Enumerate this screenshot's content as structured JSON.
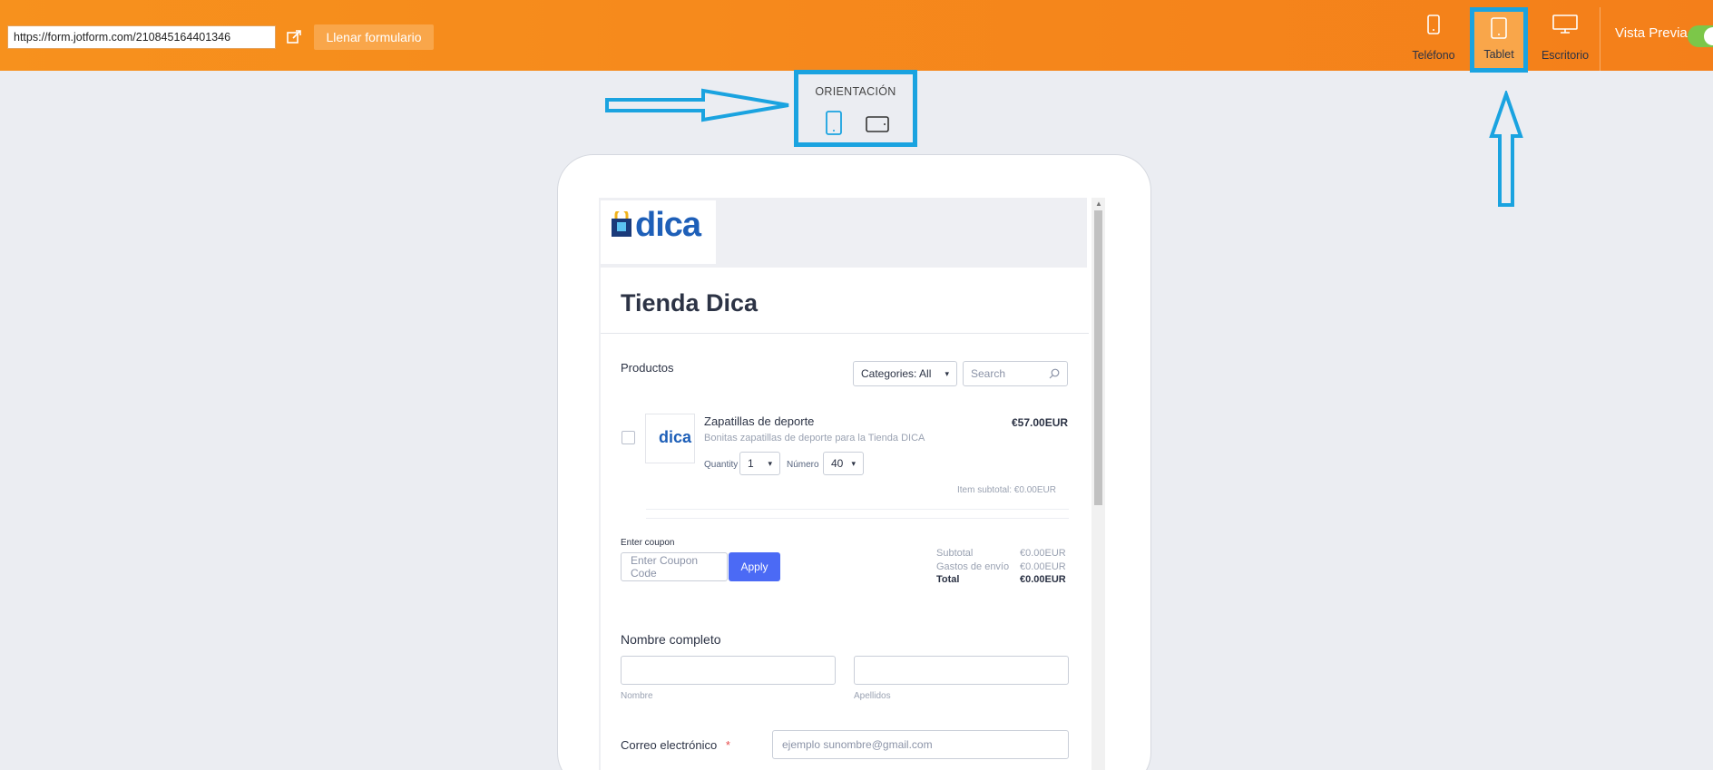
{
  "toolbar": {
    "url": "https://form.jotform.com/210845164401346",
    "fill_button": "Llenar formulario",
    "devices": [
      {
        "label": "Teléfono",
        "icon": "phone-icon"
      },
      {
        "label": "Tablet",
        "icon": "tablet-icon",
        "selected": true
      },
      {
        "label": "Escritorio",
        "icon": "desktop-icon"
      }
    ],
    "preview_label": "Vista Previa",
    "preview_on": true
  },
  "orientation": {
    "label": "ORIENTACIÓN",
    "options": [
      "portrait-icon",
      "landscape-icon"
    ]
  },
  "form": {
    "logo_text": "dica",
    "title": "Tienda Dica",
    "products_label": "Productos",
    "categories_select": "Categories: All",
    "search_placeholder": "Search",
    "product": {
      "name": "Zapatillas de deporte",
      "price": "€57.00EUR",
      "description": "Bonitas zapatillas de deporte para la Tienda DICA",
      "quantity_label": "Quantity",
      "quantity_value": "1",
      "numero_label": "Número",
      "numero_value": "40",
      "subtotal": "Item subtotal:  €0.00EUR"
    },
    "coupon": {
      "label": "Enter coupon",
      "placeholder": "Enter Coupon Code",
      "apply": "Apply"
    },
    "totals": {
      "subtotal_label": "Subtotal",
      "subtotal_value": "€0.00EUR",
      "shipping_label": "Gastos de envío",
      "shipping_value": "€0.00EUR",
      "total_label": "Total",
      "total_value": "€0.00EUR"
    },
    "name_field": {
      "label": "Nombre completo",
      "first_sub": "Nombre",
      "last_sub": "Apellidos"
    },
    "email_field": {
      "label": "Correo electrónico",
      "required_mark": "*",
      "placeholder": "ejemplo sunombre@gmail.com"
    }
  },
  "colors": {
    "topbar": "#f7911d",
    "highlight": "#1aa3e0",
    "apply": "#4b6af5"
  }
}
